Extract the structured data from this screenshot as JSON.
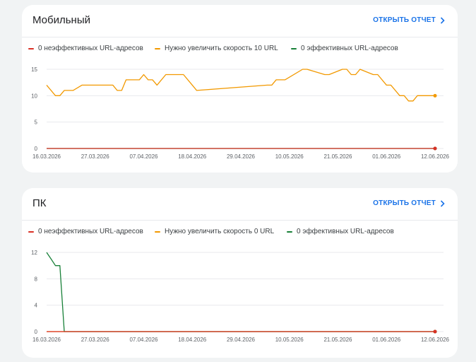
{
  "colors": {
    "red": "#d93025",
    "orange": "#f29900",
    "green": "#188038",
    "accent": "#1a73e8"
  },
  "mobile": {
    "title": "Мобильный",
    "open_report": "ОТКРЫТЬ ОТЧЕТ",
    "legend": {
      "bad": "0 неэффективных URL-адресов",
      "improve": "Нужно увеличить скорость 10 URL",
      "good": "0 эффективных URL-адресов"
    }
  },
  "pc": {
    "title": "ПК",
    "open_report": "ОТКРЫТЬ ОТЧЕТ",
    "legend": {
      "bad": "0 неэффективных URL-адресов",
      "improve": "Нужно увеличить скорость 0 URL",
      "good": "0 эффективных URL-адресов"
    }
  },
  "chart_data": [
    {
      "type": "line",
      "title": "Мобильный",
      "x_ticks": [
        "16.03.2026",
        "27.03.2026",
        "07.04.2026",
        "18.04.2026",
        "29.04.2026",
        "10.05.2026",
        "21.05.2026",
        "01.06.2026",
        "12.06.2026"
      ],
      "y_ticks": [
        0,
        5,
        10,
        15
      ],
      "ylim": [
        0,
        15
      ],
      "xlim": [
        "16.03.2026",
        "12.06.2026"
      ],
      "grid": true,
      "series": [
        {
          "name": "0 неэффективных URL-адресов",
          "color": "#d93025",
          "x": [
            "16.03.2026",
            "12.06.2026"
          ],
          "y": [
            0,
            0
          ]
        },
        {
          "name": "Нужно увеличить скорость 10 URL",
          "color": "#f29900",
          "x": [
            "16.03.2026",
            "18.03.2026",
            "19.03.2026",
            "20.03.2026",
            "21.03.2026",
            "22.03.2026",
            "24.03.2026",
            "25.03.2026",
            "31.03.2026",
            "01.04.2026",
            "02.04.2026",
            "03.04.2026",
            "06.04.2026",
            "07.04.2026",
            "08.04.2026",
            "09.04.2026",
            "10.04.2026",
            "12.04.2026",
            "16.04.2026",
            "18.04.2026",
            "19.04.2026",
            "05.05.2026",
            "06.05.2026",
            "07.05.2026",
            "09.05.2026",
            "13.05.2026",
            "14.05.2026",
            "18.05.2026",
            "19.05.2026",
            "22.05.2026",
            "23.05.2026",
            "24.05.2026",
            "25.05.2026",
            "26.05.2026",
            "29.05.2026",
            "30.05.2026",
            "01.06.2026",
            "02.06.2026",
            "04.06.2026",
            "05.06.2026",
            "06.06.2026",
            "07.06.2026",
            "08.06.2026",
            "12.06.2026"
          ],
          "y": [
            12,
            10,
            10,
            11,
            11,
            11,
            12,
            12,
            12,
            11,
            11,
            13,
            13,
            14,
            13,
            13,
            12,
            14,
            14,
            12,
            11,
            12,
            12,
            13,
            13,
            15,
            15,
            14,
            14,
            15,
            15,
            14,
            14,
            15,
            14,
            14,
            12,
            12,
            10,
            10,
            9,
            9,
            10,
            10
          ]
        },
        {
          "name": "0 эффективных URL-адресов",
          "color": "#188038",
          "x": [
            "16.03.2026",
            "12.06.2026"
          ],
          "y": [
            0,
            0
          ]
        }
      ]
    },
    {
      "type": "line",
      "title": "ПК",
      "x_ticks": [
        "16.03.2026",
        "27.03.2026",
        "07.04.2026",
        "18.04.2026",
        "29.04.2026",
        "10.05.2026",
        "21.05.2026",
        "01.06.2026",
        "12.06.2026"
      ],
      "y_ticks": [
        0,
        4,
        8,
        12
      ],
      "ylim": [
        0,
        12
      ],
      "xlim": [
        "16.03.2026",
        "12.06.2026"
      ],
      "grid": true,
      "series": [
        {
          "name": "0 неэффективных URL-адресов",
          "color": "#d93025",
          "x": [
            "16.03.2026",
            "12.06.2026"
          ],
          "y": [
            0,
            0
          ]
        },
        {
          "name": "Нужно увеличить скорость 0 URL",
          "color": "#f29900",
          "x": [
            "16.03.2026",
            "12.06.2026"
          ],
          "y": [
            0,
            0
          ]
        },
        {
          "name": "0 эффективных URL-адресов",
          "color": "#188038",
          "x": [
            "16.03.2026",
            "17.03.2026",
            "18.03.2026",
            "19.03.2026",
            "20.03.2026",
            "12.06.2026"
          ],
          "y": [
            12,
            11,
            10,
            10,
            0,
            0
          ]
        }
      ]
    }
  ]
}
